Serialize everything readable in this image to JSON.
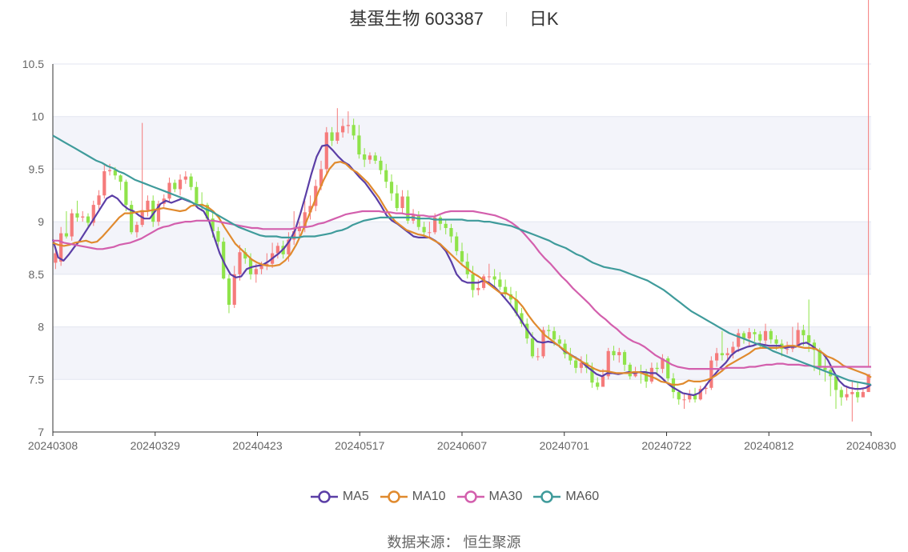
{
  "header": {
    "stock": "基蛋生物 603387",
    "period": "日K"
  },
  "source_text": "数据来源： 恒生聚源",
  "legend": [
    {
      "label": "MA5",
      "color": "#5b3ea6"
    },
    {
      "label": "MA10",
      "color": "#e08a2e"
    },
    {
      "label": "MA30",
      "color": "#d35fad"
    },
    {
      "label": "MA60",
      "color": "#3f9b9b"
    }
  ],
  "chart_data": {
    "type": "candlestick",
    "title": "基蛋生物 603387",
    "ylim": [
      7,
      10.5
    ],
    "yticks": [
      "7",
      "7.5",
      "8",
      "8.5",
      "9",
      "9.5",
      "10",
      "10.5"
    ],
    "xtick_labels": [
      "20240308",
      "20240329",
      "20240423",
      "20240517",
      "20240607",
      "20240701",
      "20240722",
      "20240812",
      "20240830"
    ],
    "up_color": "#f57b7b",
    "down_color": "#8fe34a",
    "grid": true,
    "band_color": "#f3f4fa",
    "candles": {
      "open": [
        8.61,
        8.62,
        8.89,
        8.86,
        9.08,
        9.04,
        9.05,
        8.99,
        9.16,
        9.25,
        9.48,
        9.49,
        9.44,
        9.38,
        9.16,
        8.9,
        8.97,
        9.11,
        9.2,
        9.0,
        9.17,
        9.22,
        9.37,
        9.31,
        9.4,
        9.43,
        9.33,
        9.17,
        9.16,
        9.03,
        8.91,
        8.81,
        8.46,
        8.21,
        8.5,
        8.71,
        8.65,
        8.5,
        8.55,
        8.58,
        8.6,
        8.7,
        8.77,
        8.69,
        8.83,
        8.91,
        8.94,
        9.09,
        9.15,
        9.34,
        9.5,
        9.85,
        9.77,
        9.85,
        9.91,
        9.92,
        9.82,
        9.64,
        9.59,
        9.63,
        9.58,
        9.49,
        9.38,
        9.27,
        9.13,
        9.24,
        9.01,
        9.06,
        8.95,
        8.9,
        8.9,
        9.04,
        8.98,
        8.94,
        8.86,
        8.72,
        8.62,
        8.5,
        8.35,
        8.37,
        8.48,
        8.48,
        8.45,
        8.38,
        8.31,
        8.26,
        8.13,
        8.03,
        7.89,
        7.72,
        7.72,
        7.97,
        7.96,
        7.88,
        7.84,
        7.74,
        7.68,
        7.61,
        7.66,
        7.61,
        7.47,
        7.43,
        7.53,
        7.77,
        7.73,
        7.76,
        7.64,
        7.53,
        7.57,
        7.56,
        7.48,
        7.61,
        7.6,
        7.7,
        7.51,
        7.38,
        7.31,
        7.31,
        7.36,
        7.31,
        7.41,
        7.42,
        7.68,
        7.75,
        7.73,
        7.75,
        7.81,
        7.94,
        7.89,
        7.95,
        7.93,
        7.87,
        7.96,
        7.88,
        7.84,
        7.79,
        7.79,
        7.82,
        7.97,
        7.92,
        7.85,
        7.78,
        7.61,
        7.59,
        7.53,
        7.4,
        7.33,
        7.36,
        7.38,
        7.33,
        7.38
      ],
      "close": [
        8.7,
        8.89,
        8.86,
        9.08,
        9.04,
        9.05,
        8.99,
        9.16,
        9.25,
        9.48,
        9.49,
        9.44,
        9.38,
        9.16,
        8.9,
        8.97,
        9.11,
        9.2,
        9.0,
        9.17,
        9.22,
        9.37,
        9.31,
        9.4,
        9.43,
        9.33,
        9.17,
        9.16,
        9.03,
        8.91,
        8.81,
        8.46,
        8.21,
        8.5,
        8.71,
        8.65,
        8.5,
        8.55,
        8.58,
        8.6,
        8.7,
        8.77,
        8.69,
        8.83,
        8.91,
        8.94,
        9.09,
        9.15,
        9.34,
        9.5,
        9.85,
        9.77,
        9.85,
        9.91,
        9.92,
        9.82,
        9.64,
        9.59,
        9.63,
        9.58,
        9.49,
        9.38,
        9.27,
        9.13,
        9.24,
        9.01,
        9.06,
        8.95,
        8.9,
        8.9,
        9.04,
        8.98,
        8.94,
        8.86,
        8.72,
        8.62,
        8.5,
        8.35,
        8.37,
        8.48,
        8.48,
        8.45,
        8.38,
        8.31,
        8.26,
        8.13,
        8.03,
        7.89,
        7.72,
        7.72,
        7.97,
        7.96,
        7.88,
        7.84,
        7.74,
        7.68,
        7.61,
        7.66,
        7.61,
        7.47,
        7.43,
        7.53,
        7.77,
        7.73,
        7.76,
        7.64,
        7.53,
        7.57,
        7.56,
        7.48,
        7.61,
        7.6,
        7.7,
        7.51,
        7.38,
        7.31,
        7.31,
        7.36,
        7.31,
        7.41,
        7.42,
        7.68,
        7.75,
        7.73,
        7.75,
        7.81,
        7.94,
        7.89,
        7.95,
        7.93,
        7.87,
        7.96,
        7.88,
        7.84,
        7.79,
        7.79,
        7.82,
        7.97,
        7.92,
        7.85,
        7.78,
        7.61,
        7.59,
        7.53,
        7.4,
        7.33,
        7.36,
        7.38,
        7.33,
        7.38,
        7.55
      ],
      "high": [
        8.74,
        8.95,
        9.1,
        9.12,
        9.2,
        9.1,
        9.08,
        9.2,
        9.3,
        9.55,
        9.55,
        9.52,
        9.45,
        9.4,
        9.2,
        9.0,
        9.94,
        9.25,
        9.25,
        9.2,
        9.26,
        9.42,
        9.4,
        9.45,
        9.48,
        9.46,
        9.38,
        9.28,
        9.18,
        9.1,
        8.95,
        8.85,
        8.5,
        8.58,
        8.78,
        8.75,
        8.7,
        8.6,
        8.62,
        8.7,
        8.8,
        8.8,
        8.82,
        8.9,
        9.1,
        9.0,
        9.2,
        9.25,
        9.4,
        9.58,
        9.9,
        9.9,
        10.08,
        9.98,
        10.05,
        9.98,
        9.92,
        9.7,
        9.66,
        9.66,
        9.62,
        9.55,
        9.45,
        9.35,
        9.3,
        9.3,
        9.12,
        9.1,
        9.0,
        9.0,
        9.08,
        9.06,
        9.02,
        8.98,
        8.9,
        8.8,
        8.7,
        8.58,
        8.45,
        8.5,
        8.6,
        8.55,
        8.52,
        8.45,
        8.38,
        8.34,
        8.18,
        8.08,
        7.95,
        7.8,
        8.0,
        8.02,
        8.0,
        7.92,
        7.88,
        7.8,
        7.72,
        7.72,
        7.74,
        7.66,
        7.52,
        7.6,
        7.8,
        7.82,
        7.8,
        7.78,
        7.66,
        7.62,
        7.64,
        7.6,
        7.66,
        7.66,
        7.74,
        7.72,
        7.56,
        7.4,
        7.36,
        7.4,
        7.42,
        7.44,
        7.46,
        7.72,
        7.8,
        7.96,
        7.8,
        7.86,
        7.98,
        7.96,
        7.99,
        7.98,
        7.96,
        8.03,
        7.98,
        7.92,
        7.88,
        7.86,
        8.0,
        8.04,
        8.02,
        8.26,
        7.88,
        7.8,
        7.7,
        7.64,
        7.55,
        7.43,
        7.44,
        7.48,
        7.48,
        7.42,
        7.62
      ],
      "low": [
        8.55,
        8.58,
        8.84,
        8.82,
        9.0,
        9.0,
        8.95,
        8.96,
        9.12,
        9.22,
        9.44,
        9.4,
        9.3,
        9.1,
        8.88,
        8.85,
        8.95,
        9.05,
        8.95,
        8.96,
        9.14,
        9.18,
        9.28,
        9.25,
        9.36,
        9.3,
        9.14,
        9.1,
        9.0,
        8.85,
        8.75,
        8.45,
        8.13,
        8.18,
        8.44,
        8.6,
        8.45,
        8.42,
        8.5,
        8.54,
        8.56,
        8.65,
        8.65,
        8.62,
        8.78,
        8.85,
        8.9,
        9.02,
        9.1,
        9.3,
        9.45,
        9.72,
        9.74,
        9.8,
        9.84,
        9.78,
        9.6,
        9.52,
        9.55,
        9.55,
        9.45,
        9.32,
        9.2,
        9.1,
        9.08,
        8.98,
        8.98,
        8.92,
        8.86,
        8.85,
        8.88,
        8.92,
        8.88,
        8.8,
        8.68,
        8.58,
        8.46,
        8.28,
        8.3,
        8.35,
        8.42,
        8.38,
        8.35,
        8.28,
        8.22,
        8.1,
        8.0,
        7.84,
        7.7,
        7.68,
        7.7,
        7.9,
        7.82,
        7.8,
        7.7,
        7.64,
        7.56,
        7.56,
        7.56,
        7.42,
        7.4,
        7.44,
        7.5,
        7.68,
        7.66,
        7.58,
        7.5,
        7.52,
        7.46,
        7.42,
        7.46,
        7.54,
        7.56,
        7.48,
        7.32,
        7.26,
        7.22,
        7.28,
        7.28,
        7.3,
        7.36,
        7.4,
        7.62,
        7.68,
        7.68,
        7.7,
        7.76,
        7.84,
        7.82,
        7.86,
        7.8,
        7.82,
        7.84,
        7.78,
        7.72,
        7.74,
        7.76,
        7.88,
        7.82,
        7.76,
        7.58,
        7.54,
        7.48,
        7.34,
        7.22,
        7.25,
        7.3,
        7.1,
        7.28,
        7.34
      ]
    },
    "series": [
      {
        "name": "MA5",
        "color": "#5b3ea6",
        "values": [
          8.83,
          8.66,
          8.63,
          8.69,
          8.76,
          8.82,
          8.9,
          8.98,
          9.06,
          9.14,
          9.22,
          9.25,
          9.22,
          9.16,
          9.12,
          9.1,
          9.06,
          9.03,
          9.03,
          9.1,
          9.17,
          9.2,
          9.18,
          9.2,
          9.22,
          9.2,
          9.18,
          9.13,
          9.1,
          9.01,
          8.85,
          8.7,
          8.59,
          8.5,
          8.47,
          8.48,
          8.55,
          8.57,
          8.58,
          8.59,
          8.62,
          8.66,
          8.7,
          8.75,
          8.82,
          8.92,
          9.08,
          9.26,
          9.45,
          9.62,
          9.72,
          9.73,
          9.68,
          9.62,
          9.57,
          9.54,
          9.48,
          9.42,
          9.37,
          9.3,
          9.23,
          9.15,
          9.06,
          9.01,
          8.98,
          8.94,
          8.9,
          8.86,
          8.85,
          8.85,
          8.85,
          8.82,
          8.78,
          8.72,
          8.62,
          8.5,
          8.44,
          8.42,
          8.42,
          8.42,
          8.44,
          8.42,
          8.38,
          8.33,
          8.27,
          8.21,
          8.14,
          8.06,
          7.98,
          7.91,
          7.86,
          7.85,
          7.86,
          7.85,
          7.82,
          7.77,
          7.74,
          7.71,
          7.68,
          7.63,
          7.59,
          7.55,
          7.53,
          7.56,
          7.56,
          7.55,
          7.56,
          7.57,
          7.56,
          7.57,
          7.57,
          7.56,
          7.56,
          7.52,
          7.47,
          7.43,
          7.4,
          7.37,
          7.36,
          7.35,
          7.37,
          7.42,
          7.49,
          7.55,
          7.61,
          7.66,
          7.73,
          7.77,
          7.79,
          7.81,
          7.82,
          7.84,
          7.83,
          7.82,
          7.82,
          7.82,
          7.8,
          7.81,
          7.81,
          7.84,
          7.85,
          7.82,
          7.78,
          7.75,
          7.68,
          7.58,
          7.49,
          7.44,
          7.42,
          7.41,
          7.41,
          7.42,
          7.45
        ]
      },
      {
        "name": "MA10",
        "color": "#e08a2e",
        "values": [
          8.8,
          8.78,
          8.77,
          8.78,
          8.8,
          8.81,
          8.82,
          8.8,
          8.81,
          8.86,
          8.92,
          8.98,
          9.04,
          9.08,
          9.08,
          9.09,
          9.1,
          9.1,
          9.11,
          9.12,
          9.13,
          9.12,
          9.11,
          9.1,
          9.11,
          9.15,
          9.16,
          9.16,
          9.14,
          9.1,
          9.04,
          8.95,
          8.87,
          8.79,
          8.74,
          8.69,
          8.64,
          8.61,
          8.59,
          8.58,
          8.58,
          8.59,
          8.63,
          8.69,
          8.78,
          8.89,
          9.02,
          9.15,
          9.28,
          9.4,
          9.5,
          9.56,
          9.57,
          9.55,
          9.5,
          9.47,
          9.42,
          9.37,
          9.3,
          9.23,
          9.14,
          9.06,
          9.0,
          8.96,
          8.92,
          8.9,
          8.88,
          8.87,
          8.85,
          8.82,
          8.79,
          8.74,
          8.69,
          8.64,
          8.59,
          8.55,
          8.51,
          8.48,
          8.44,
          8.4,
          8.36,
          8.32,
          8.32,
          8.29,
          8.25,
          8.19,
          8.11,
          8.04,
          7.98,
          7.92,
          7.88,
          7.84,
          7.8,
          7.76,
          7.72,
          7.69,
          7.66,
          7.63,
          7.6,
          7.58,
          7.58,
          7.57,
          7.56,
          7.56,
          7.56,
          7.57,
          7.57,
          7.55,
          7.53,
          7.51,
          7.48,
          7.47,
          7.45,
          7.45,
          7.46,
          7.49,
          7.48,
          7.48,
          7.49,
          7.51,
          7.54,
          7.58,
          7.63,
          7.66,
          7.69,
          7.72,
          7.75,
          7.79,
          7.8,
          7.8,
          7.8,
          7.8,
          7.81,
          7.82,
          7.82,
          7.81,
          7.8,
          7.8,
          7.79,
          7.76,
          7.72,
          7.7,
          7.67,
          7.63,
          7.61,
          7.59,
          7.57,
          7.55,
          7.52
        ]
      },
      {
        "name": "MA30",
        "color": "#d35fad",
        "values": [
          8.82,
          8.82,
          8.8,
          8.79,
          8.78,
          8.77,
          8.76,
          8.75,
          8.74,
          8.74,
          8.75,
          8.76,
          8.78,
          8.79,
          8.8,
          8.82,
          8.84,
          8.87,
          8.9,
          8.93,
          8.95,
          8.96,
          8.98,
          8.99,
          9.0,
          9.0,
          9.01,
          9.01,
          9.01,
          9.01,
          9.0,
          8.99,
          8.98,
          8.97,
          8.96,
          8.95,
          8.94,
          8.94,
          8.93,
          8.93,
          8.93,
          8.93,
          8.93,
          8.93,
          8.94,
          8.95,
          8.95,
          8.96,
          8.98,
          8.99,
          9.01,
          9.03,
          9.05,
          9.07,
          9.08,
          9.09,
          9.1,
          9.1,
          9.1,
          9.1,
          9.09,
          9.09,
          9.08,
          9.08,
          9.07,
          9.07,
          9.06,
          9.06,
          9.05,
          9.05,
          9.07,
          9.09,
          9.1,
          9.1,
          9.1,
          9.1,
          9.1,
          9.09,
          9.08,
          9.07,
          9.06,
          9.04,
          9.02,
          8.99,
          8.95,
          8.9,
          8.84,
          8.78,
          8.71,
          8.65,
          8.6,
          8.54,
          8.48,
          8.43,
          8.37,
          8.32,
          8.27,
          8.22,
          8.16,
          8.11,
          8.07,
          8.02,
          7.98,
          7.93,
          7.89,
          7.86,
          7.84,
          7.81,
          7.77,
          7.73,
          7.7,
          7.67,
          7.64,
          7.62,
          7.61,
          7.6,
          7.6,
          7.6,
          7.6,
          7.6,
          7.6,
          7.6,
          7.61,
          7.61,
          7.61,
          7.61,
          7.62,
          7.62,
          7.63,
          7.64,
          7.64,
          7.65,
          7.65,
          7.64,
          7.64,
          7.64,
          7.63,
          7.63,
          7.62,
          7.62,
          7.62,
          7.62,
          7.62,
          7.62,
          7.62,
          7.62,
          7.62,
          7.62,
          7.62
        ]
      },
      {
        "name": "MA60",
        "color": "#3f9b9b",
        "values": [
          9.82,
          9.79,
          9.76,
          9.73,
          9.7,
          9.67,
          9.64,
          9.61,
          9.58,
          9.56,
          9.53,
          9.51,
          9.48,
          9.46,
          9.43,
          9.4,
          9.38,
          9.36,
          9.34,
          9.32,
          9.3,
          9.28,
          9.26,
          9.24,
          9.22,
          9.2,
          9.17,
          9.15,
          9.12,
          9.1,
          9.07,
          9.04,
          9.01,
          8.98,
          8.95,
          8.93,
          8.91,
          8.89,
          8.87,
          8.86,
          8.86,
          8.86,
          8.85,
          8.85,
          8.85,
          8.85,
          8.86,
          8.86,
          8.86,
          8.87,
          8.88,
          8.89,
          8.91,
          8.92,
          8.94,
          8.97,
          8.99,
          9.01,
          9.02,
          9.03,
          9.04,
          9.04,
          9.04,
          9.04,
          9.04,
          9.04,
          9.04,
          9.03,
          9.03,
          9.03,
          9.02,
          9.02,
          9.02,
          9.02,
          9.02,
          9.02,
          9.01,
          9.01,
          9.01,
          9.0,
          9.0,
          8.99,
          8.98,
          8.97,
          8.96,
          8.94,
          8.92,
          8.9,
          8.88,
          8.86,
          8.84,
          8.82,
          8.79,
          8.77,
          8.75,
          8.72,
          8.69,
          8.67,
          8.64,
          8.61,
          8.59,
          8.57,
          8.56,
          8.55,
          8.54,
          8.52,
          8.5,
          8.48,
          8.46,
          8.44,
          8.41,
          8.38,
          8.35,
          8.31,
          8.27,
          8.23,
          8.19,
          8.15,
          8.12,
          8.09,
          8.06,
          8.03,
          8.0,
          7.97,
          7.94,
          7.92,
          7.9,
          7.88,
          7.86,
          7.84,
          7.82,
          7.8,
          7.77,
          7.75,
          7.73,
          7.71,
          7.69,
          7.67,
          7.65,
          7.63,
          7.61,
          7.59,
          7.57,
          7.55,
          7.53,
          7.51,
          7.49,
          7.48,
          7.47,
          7.46,
          7.45
        ]
      }
    ]
  }
}
